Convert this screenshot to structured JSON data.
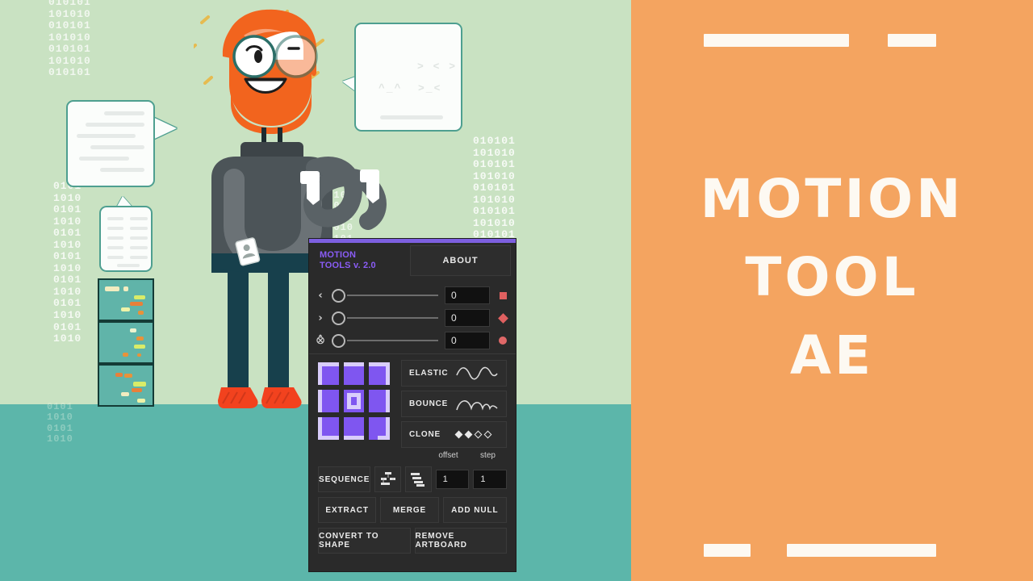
{
  "scene": {
    "binary_rows_a": "010101\n101010\n010101\n101010\n010101\n101010\n010101",
    "binary_rows_b": "0101\n1010\n0101\n1010\n0101\n1010\n0101\n1010\n0101\n1010\n0101\n1010\n0101\n1010",
    "binary_rows_c": "010101\n101010\n010101\n101010\n010101\n101010\n010101\n101010\n010101\n101010\n010101\n101010",
    "binary_rows_d": "0101010101\n1010101010\n0101010101\n1010101010\n0101010101",
    "binary_rows_e": "0101\n1010\n0101\n1010",
    "bubble_code_line1": "> < >",
    "bubble_code_line2": "^_^  >_<"
  },
  "right_panel": {
    "background_color": "#f4a460",
    "title_lines": [
      "MOTION",
      "TOOL",
      "AE"
    ],
    "text_color": "#fdf9f2"
  },
  "tool_panel": {
    "accent_color": "#7d5fe0",
    "brand_line1": "MOTION",
    "brand_line2": "TOOLS v. 2.0",
    "about_label": "ABOUT",
    "sliders": [
      {
        "icon": "chevron-left-icon",
        "glyph": "‹",
        "value": "0",
        "marker": "square"
      },
      {
        "icon": "chevron-right-icon",
        "glyph": "›",
        "value": "0",
        "marker": "diamond"
      },
      {
        "icon": "both-ways-icon",
        "glyph": "⨶",
        "value": "0",
        "marker": "circle"
      }
    ],
    "anchor_grid": {
      "label": "anchor-point-grid",
      "cells": [
        "top-left",
        "top-center",
        "top-right",
        "middle-left",
        "center",
        "middle-right",
        "bottom-left",
        "bottom-center",
        "bottom-right"
      ]
    },
    "effects": [
      {
        "label": "ELASTIC",
        "icon": "elastic-wave-icon"
      },
      {
        "label": "BOUNCE",
        "icon": "bounce-wave-icon"
      },
      {
        "label": "CLONE",
        "icon": "clone-diamonds-icon"
      }
    ],
    "offset_label": "offset",
    "step_label": "step",
    "sequence_label": "SEQUENCE",
    "sequence_icon_1": "align-layers-icon",
    "sequence_icon_2": "stagger-layers-icon",
    "offset_value": "1",
    "step_value": "1",
    "buttons_row2": [
      "EXTRACT",
      "MERGE",
      "ADD NULL"
    ],
    "buttons_row3": [
      "CONVERT TO SHAPE",
      "REMOVE ARTBOARD"
    ]
  }
}
